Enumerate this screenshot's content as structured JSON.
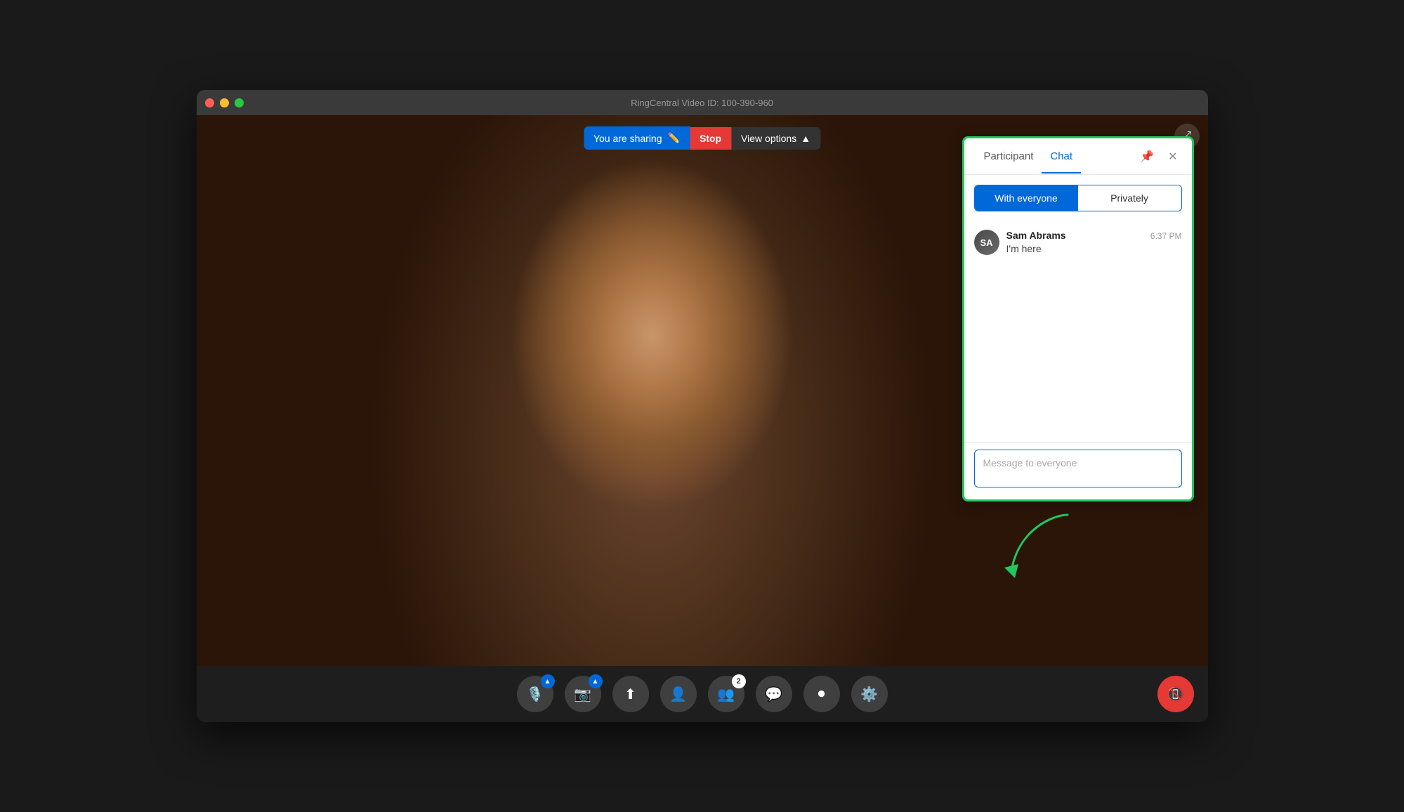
{
  "window": {
    "title": "RingCentral Video ID: 100-390-960"
  },
  "sharing_bar": {
    "text": "You are sharing",
    "stop_label": "Stop",
    "view_options_label": "View options"
  },
  "chat_panel": {
    "tab_participant": "Participant",
    "tab_chat": "Chat",
    "audience_everyone": "With everyone",
    "audience_privately": "Privately",
    "message_placeholder": "Message to everyone",
    "message": {
      "author": "Sam Abrams",
      "time": "6:37 PM",
      "text": "I'm here"
    }
  },
  "toolbar": {
    "mic_label": "Microphone",
    "camera_label": "Camera",
    "share_label": "Share",
    "participants_label": "Participants",
    "invite_label": "Invite",
    "chat_label": "Chat",
    "record_label": "Record",
    "settings_label": "Settings",
    "end_label": "End call",
    "participant_count": "2"
  }
}
